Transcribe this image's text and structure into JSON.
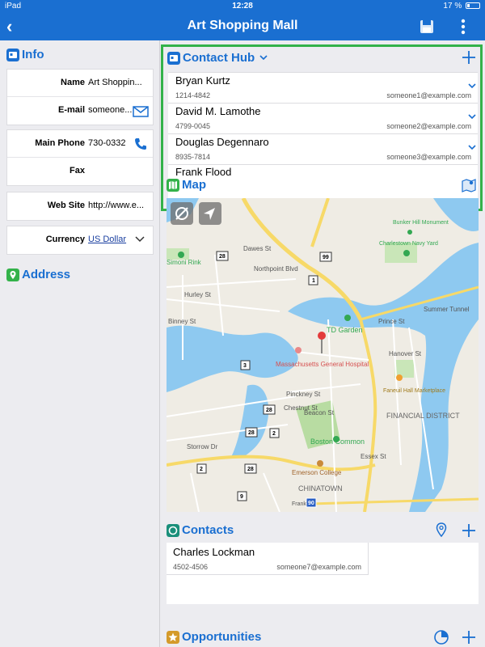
{
  "status": {
    "device": "iPad",
    "time": "12:28",
    "battery": "17 %"
  },
  "nav": {
    "title": "Art Shopping Mall"
  },
  "info": {
    "header": "Info",
    "fields": [
      {
        "label": "Name",
        "value": "Art Shoppin..."
      },
      {
        "label": "E-mail",
        "value": "someone..."
      },
      {
        "label": "Main Phone",
        "value": "730-0332"
      },
      {
        "label": "Fax",
        "value": ""
      },
      {
        "label": "Web Site",
        "value": "http://www.e..."
      },
      {
        "label": "Currency",
        "value": "US Dollar"
      }
    ]
  },
  "address": {
    "header": "Address"
  },
  "contact_hub": {
    "header": "Contact Hub",
    "contacts": [
      {
        "name": "Bryan Kurtz",
        "phone": "1214-4842",
        "email": "someone1@example.com"
      },
      {
        "name": "David M. Lamothe",
        "phone": "4799-0045",
        "email": "someone2@example.com"
      },
      {
        "name": "Douglas Degennaro",
        "phone": "8935-7814",
        "email": "someone3@example.com"
      },
      {
        "name": "Frank Flood",
        "phone": "",
        "email": ""
      }
    ]
  },
  "map": {
    "header": "Map",
    "labels": {
      "td_garden": "TD Garden",
      "mgh": "Massachusetts General Hospital",
      "boston_common": "Boston Common",
      "emerson": "Emerson College",
      "chinatown": "CHINATOWN",
      "financial": "FINANCIAL DISTRICT",
      "charlestown": "Charlestown Navy Yard",
      "bunker": "Bunker Hill Monument",
      "faneuil": "Faneuil Hall Marketplace",
      "frankfurt": "Frankfurt",
      "simoni": "Simoni Rink",
      "hurley": "Hurley St",
      "binney": "Binney St",
      "dawes": "Dawes St",
      "northpoint": "Northpoint Blvd",
      "prince": "Prince St",
      "hanover": "Hanover St",
      "beacon": "Beacon St",
      "pinckney": "Pinckney St",
      "chestnut": "Chestnut St",
      "storrow": "Storrow Dr",
      "summer": "Summer Tunnel",
      "essex": "Essex St",
      "shields": [
        "28",
        "99",
        "1",
        "3",
        "28",
        "2",
        "28",
        "2",
        "28",
        "9",
        "90"
      ]
    }
  },
  "contacts": {
    "header": "Contacts",
    "items": [
      {
        "name": "Charles Lockman",
        "phone": "4502-4506",
        "email": "someone7@example.com"
      }
    ]
  },
  "opportunities": {
    "header": "Opportunities"
  }
}
